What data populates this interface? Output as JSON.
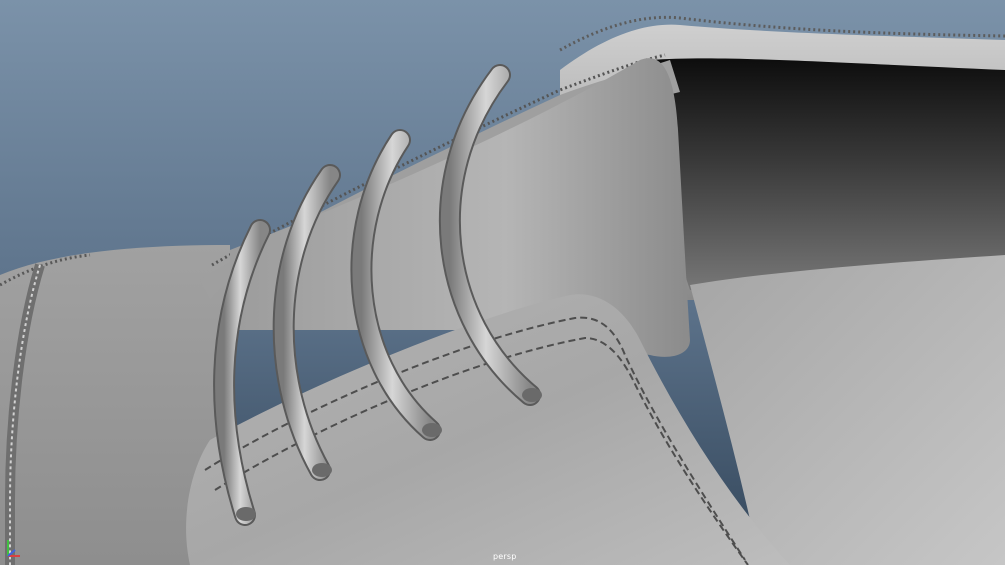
{
  "viewport": {
    "camera_name": "persp",
    "background_top": "#7b92a9",
    "background_bottom": "#33465a"
  },
  "scene": {
    "subject": "shoe-model",
    "shading": "smooth-shaded-grey"
  },
  "axis_gizmo": {
    "x_color": "#d94040",
    "y_color": "#40c040",
    "z_color": "#4060e0"
  }
}
